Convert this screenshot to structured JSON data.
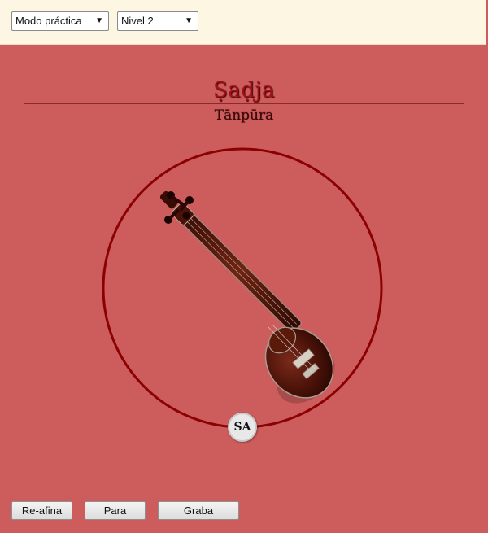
{
  "toolbar": {
    "mode_select": "Modo práctica",
    "level_select": "Nivel 2"
  },
  "header": {
    "title": "Ṣaḍja",
    "subtitle": "Tānpūra"
  },
  "stage": {
    "note_label": "SA",
    "instrument_icon": "tanpura-icon",
    "circle_color": "#8b0000"
  },
  "controls": {
    "retune_label": "Re-afina",
    "stop_label": "Para",
    "record_label": "Graba"
  },
  "colors": {
    "background": "#cd5c5c",
    "topbar": "#fdf6e3",
    "title": "#9e1118"
  }
}
